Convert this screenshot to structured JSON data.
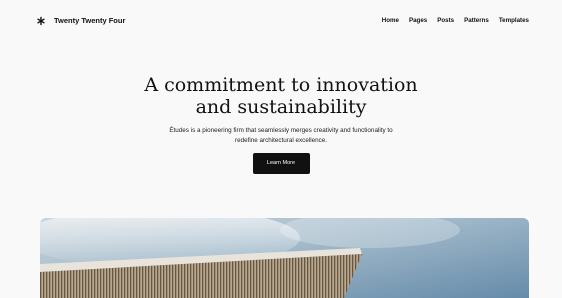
{
  "header": {
    "site_title": "Twenty Twenty Four",
    "logo_icon": "asterisk-logo-icon",
    "nav": [
      {
        "label": "Home"
      },
      {
        "label": "Pages"
      },
      {
        "label": "Posts"
      },
      {
        "label": "Patterns"
      },
      {
        "label": "Templates"
      }
    ]
  },
  "hero": {
    "title": "A commitment to innovation and sustainability",
    "description": "Études is a pioneering firm that seamlessly merges creativity and functionality to redefine architectural excellence.",
    "cta_label": "Learn More"
  },
  "image": {
    "icon": "architecture-photo"
  },
  "colors": {
    "background": "#f9f9f9",
    "text": "#111111",
    "button_bg": "#111111",
    "button_text": "#ffffff"
  }
}
